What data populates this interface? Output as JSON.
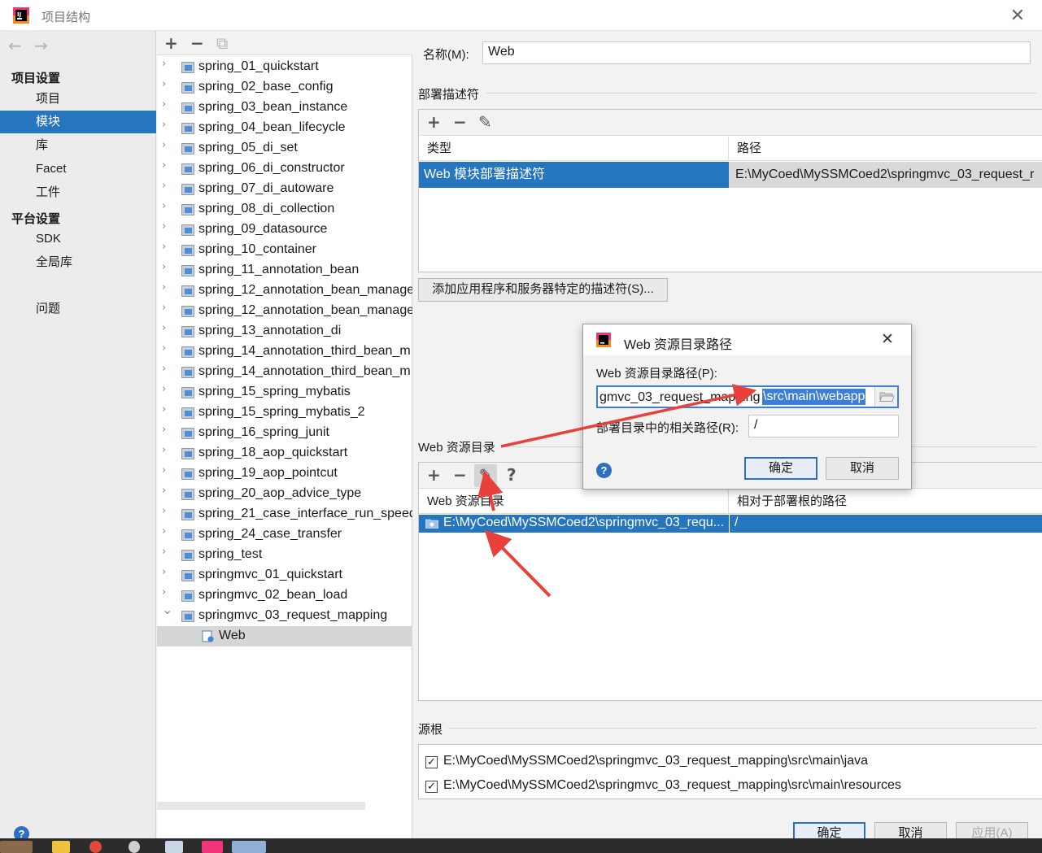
{
  "window": {
    "title": "项目结构",
    "close_glyph": "✕"
  },
  "nav": {
    "back_glyph": "←",
    "forward_glyph": "→",
    "project_settings_header": "项目设置",
    "project_items": [
      "项目",
      "模块",
      "库",
      "Facet",
      "工件"
    ],
    "platform_settings_header": "平台设置",
    "platform_items": [
      "SDK",
      "全局库"
    ],
    "problems": "问题",
    "selected": "模块"
  },
  "tree": {
    "toolbar": {
      "add_glyph": "+",
      "remove_glyph": "−",
      "copy_glyph": "⧉"
    },
    "modules": [
      "spring_01_quickstart",
      "spring_02_base_config",
      "spring_03_bean_instance",
      "spring_04_bean_lifecycle",
      "spring_05_di_set",
      "spring_06_di_constructor",
      "spring_07_di_autoware",
      "spring_08_di_collection",
      "spring_09_datasource",
      "spring_10_container",
      "spring_11_annotation_bean",
      "spring_12_annotation_bean_manage",
      "spring_12_annotation_bean_manage",
      "spring_13_annotation_di",
      "spring_14_annotation_third_bean_m",
      "spring_14_annotation_third_bean_m",
      "spring_15_spring_mybatis",
      "spring_15_spring_mybatis_2",
      "spring_16_spring_junit",
      "spring_18_aop_quickstart",
      "spring_19_aop_pointcut",
      "spring_20_aop_advice_type",
      "spring_21_case_interface_run_speed",
      "spring_24_case_transfer",
      "spring_test",
      "springmvc_01_quickstart",
      "springmvc_02_bean_load",
      "springmvc_03_request_mapping"
    ],
    "child_facet": "Web"
  },
  "details": {
    "name_label": "名称(M):",
    "name_value": "Web",
    "deploy_section": "部署描述符",
    "deploy_col_type": "类型",
    "deploy_col_path": "路径",
    "deploy_row_type": "Web 模块部署描述符",
    "deploy_row_path": "E:\\MyCoed\\MySSMCoed2\\springmvc_03_request_r",
    "add_descriptor_button": "添加应用程序和服务器特定的描述符(S)...",
    "web_res_section": "Web 资源目录",
    "web_res_col_dir": "Web 资源目录",
    "web_res_col_rel": "相对于部署根的路径",
    "web_res_row_dir": "E:\\MyCoed\\MySSMCoed2\\springmvc_03_requ...",
    "web_res_row_rel": "/",
    "source_roots_section": "源根",
    "source_roots": [
      "E:\\MyCoed\\MySSMCoed2\\springmvc_03_request_mapping\\src\\main\\java",
      "E:\\MyCoed\\MySSMCoed2\\springmvc_03_request_mapping\\src\\main\\resources"
    ],
    "toolbar": {
      "add_glyph": "+",
      "remove_glyph": "−",
      "edit_glyph": "✎",
      "help_glyph": "?"
    },
    "check_glyph": "✓"
  },
  "dialog": {
    "title": "Web 资源目录路径",
    "path_label": "Web 资源目录路径(P):",
    "path_value_plain": "gmvc_03_request_mapping",
    "path_value_selected": "\\src\\main\\webapp",
    "relative_label": "部署目录中的相关路径(R):",
    "relative_value": "/",
    "ok_button": "确定",
    "cancel_button": "取消",
    "help_glyph": "?",
    "close_glyph": "✕"
  },
  "footer": {
    "help_glyph": "?",
    "ok_button": "确定",
    "cancel_button": "取消",
    "apply_button": "应用(A)"
  },
  "colors": {
    "selection": "#2675bf",
    "annotation_arrow": "#e8403a",
    "dialog_selection": "#3d7fd6"
  }
}
